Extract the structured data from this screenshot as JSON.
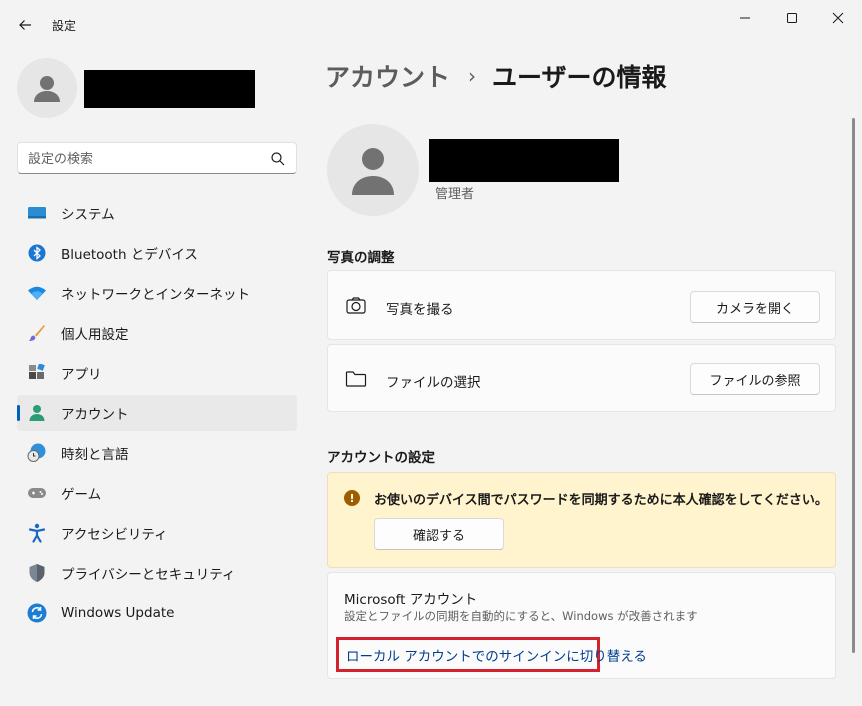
{
  "window": {
    "title": "設定"
  },
  "sidebar": {
    "search_placeholder": "設定の検索",
    "items": [
      {
        "label": "システム",
        "icon": "system-icon"
      },
      {
        "label": "Bluetooth とデバイス",
        "icon": "bluetooth-icon"
      },
      {
        "label": "ネットワークとインターネット",
        "icon": "wifi-icon"
      },
      {
        "label": "個人用設定",
        "icon": "brush-icon"
      },
      {
        "label": "アプリ",
        "icon": "apps-icon"
      },
      {
        "label": "アカウント",
        "icon": "account-icon",
        "active": true
      },
      {
        "label": "時刻と言語",
        "icon": "clock-globe-icon"
      },
      {
        "label": "ゲーム",
        "icon": "gamepad-icon"
      },
      {
        "label": "アクセシビリティ",
        "icon": "accessibility-icon"
      },
      {
        "label": "プライバシーとセキュリティ",
        "icon": "shield-icon"
      },
      {
        "label": "Windows Update",
        "icon": "update-icon"
      }
    ]
  },
  "breadcrumb": {
    "parent": "アカウント",
    "separator": "›",
    "current": "ユーザーの情報"
  },
  "user": {
    "role": "管理者"
  },
  "photo_section": {
    "title": "写真の調整",
    "take_photo": {
      "label": "写真を撮る",
      "button": "カメラを開く"
    },
    "choose_file": {
      "label": "ファイルの選択",
      "button": "ファイルの参照"
    }
  },
  "account_settings": {
    "title": "アカウントの設定",
    "warning": {
      "text": "お使いのデバイス間でパスワードを同期するために本人確認をしてください。",
      "button": "確認する"
    },
    "microsoft": {
      "title": "Microsoft アカウント",
      "description": "設定とファイルの同期を自動的にすると、Windows が改善されます",
      "link": "ローカル アカウントでのサインインに切り替える"
    }
  },
  "colors": {
    "accent": "#005fb8",
    "warning_bg": "#fff4ce",
    "highlight_border": "#d4212e",
    "link": "#003e92"
  }
}
